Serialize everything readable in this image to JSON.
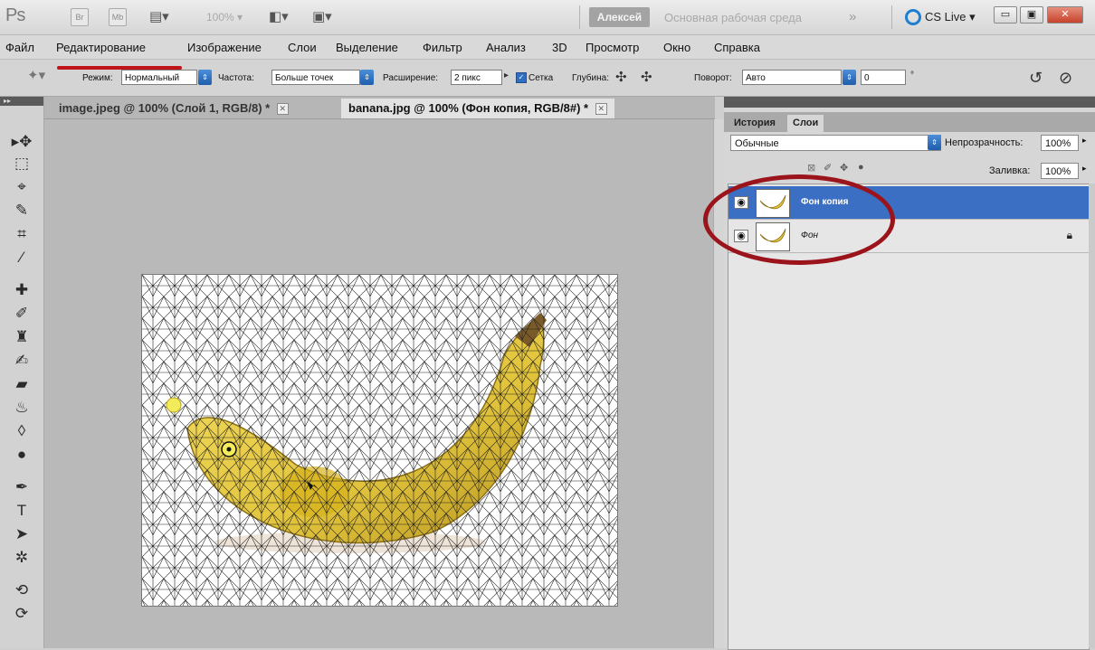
{
  "app": {
    "logo": "Ps",
    "bridge_label": "Br",
    "mini_bridge_label": "Mb",
    "zoom": "100%",
    "user": "Алексей",
    "workspace": "Основная рабочая среда",
    "more": "»",
    "cs_live": "CS Live",
    "cs_live_arrow": "▾",
    "window_buttons": {
      "minimize": "▭",
      "restore": "▣",
      "close": "✕"
    }
  },
  "menu": [
    "Файл",
    "Редактирование",
    "Изображение",
    "Слои",
    "Выделение",
    "Фильтр",
    "Анализ",
    "3D",
    "Просмотр",
    "Окно",
    "Справка"
  ],
  "options": {
    "mode_label": "Режим:",
    "mode_value": "Нормальный",
    "density_label": "Частота:",
    "density_value": "Больше точек",
    "expansion_label": "Расширение:",
    "expansion_value": "2 пикс",
    "mesh_label": "Сетка",
    "mesh_checked": true,
    "depth_label": "Глубина:",
    "rotate_label": "Поворот:",
    "rotate_value": "Авто",
    "angle_value": "0",
    "degree_symbol": "°"
  },
  "documents": {
    "tabs": [
      {
        "label": "image.jpeg @ 100% (Слой 1, RGB/8) *",
        "active": false
      },
      {
        "label": "banana.jpg @ 100% (Фон копия, RGB/8#) *",
        "active": true
      }
    ],
    "close_glyph": "✕"
  },
  "toolbox": {
    "tools": [
      {
        "name": "move-tool",
        "glyph": "▸✥"
      },
      {
        "name": "marquee-tool",
        "glyph": "⬚"
      },
      {
        "name": "lasso-tool",
        "glyph": "⌖"
      },
      {
        "name": "quick-selection-tool",
        "glyph": "✎"
      },
      {
        "name": "crop-tool",
        "glyph": "⌗"
      },
      {
        "name": "eyedropper-tool",
        "glyph": "⁄"
      },
      {
        "name": "spot-healing-tool",
        "glyph": "✚"
      },
      {
        "name": "brush-tool",
        "glyph": "✐"
      },
      {
        "name": "clone-stamp-tool",
        "glyph": "♜"
      },
      {
        "name": "history-brush-tool",
        "glyph": "✍"
      },
      {
        "name": "eraser-tool",
        "glyph": "▰"
      },
      {
        "name": "paint-bucket-tool",
        "glyph": "♨"
      },
      {
        "name": "blur-tool",
        "glyph": "◊"
      },
      {
        "name": "dodge-tool",
        "glyph": "●"
      },
      {
        "name": "pen-tool",
        "glyph": "✒"
      },
      {
        "name": "type-tool",
        "glyph": "T"
      },
      {
        "name": "path-selection-tool",
        "glyph": "➤"
      },
      {
        "name": "custom-shape-tool",
        "glyph": "✲"
      },
      {
        "name": "3d-rotate-tool",
        "glyph": "⟲"
      },
      {
        "name": "3d-orbit-tool",
        "glyph": "⟳"
      }
    ]
  },
  "layers_panel": {
    "tabs": [
      {
        "label": "История",
        "active": false
      },
      {
        "label": "Слои",
        "active": true
      }
    ],
    "blend_mode": "Обычные",
    "opacity_label": "Непрозрачность:",
    "opacity_value": "100%",
    "fill_label": "Заливка:",
    "fill_value": "100%",
    "layers": [
      {
        "name": "Фон копия",
        "selected": true,
        "locked": false
      },
      {
        "name": "Фон",
        "selected": false,
        "locked": true
      }
    ]
  },
  "colors": {
    "selection_blue": "#3a6fc4",
    "annotation_red": "#9b141b",
    "banana_yellow": "#e9cf45"
  }
}
